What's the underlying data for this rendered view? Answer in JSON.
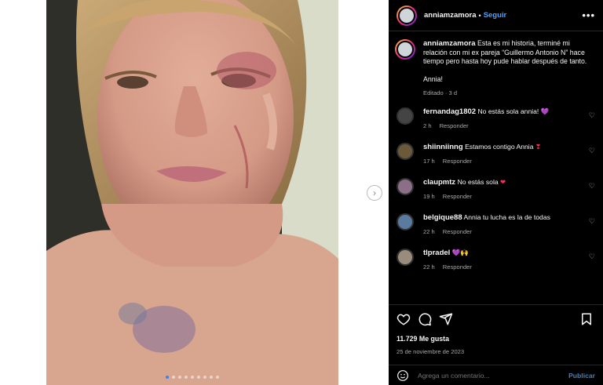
{
  "post": {
    "username": "anniamzamora",
    "follow_label": "Seguir",
    "more_label": "•••",
    "image_dots": 9,
    "active_dot": 0
  },
  "caption": {
    "username": "anniamzamora",
    "text": "Esta es mi historia, terminé mi relación con mi ex pareja “Guillermo Antonio N” hace tiempo pero hasta hoy pude hablar después de tanto.",
    "signature": "Annia!",
    "meta": "Editado · 3 d"
  },
  "comments": [
    {
      "username": "fernandag1802",
      "text": "No estás sola annia!",
      "emoji": "💜",
      "time": "2 h",
      "reply": "Responder",
      "avatar_color": "#444444"
    },
    {
      "username": "shiinniinng",
      "text": "Estamos contigo Annia",
      "emoji": "❣",
      "time": "17 h",
      "reply": "Responder",
      "avatar_color": "#6b5a3a"
    },
    {
      "username": "claupmtz",
      "text": "No estás sola",
      "emoji": "❤",
      "time": "19 h",
      "reply": "Responder",
      "avatar_color": "#8a6f86"
    },
    {
      "username": "belgique88",
      "text": "Annia tu lucha es la de todas",
      "emoji": "",
      "time": "22 h",
      "reply": "Responder",
      "avatar_color": "#5b7aa0"
    },
    {
      "username": "tlpradel",
      "text": "",
      "emoji": "💜🙌",
      "time": "22 h",
      "reply": "Responder",
      "avatar_color": "#9a8c7d"
    }
  ],
  "likes": "11.729 Me gusta",
  "date": "25 de noviembre de 2023",
  "add_comment": {
    "placeholder": "Agrega un comentario...",
    "publish_label": "Publicar"
  },
  "colors": {
    "panel_bg": "#000000",
    "follow": "#4aa3ff",
    "publish": "#4f7fb0",
    "muted": "#a8a8a8"
  },
  "icons": [
    "like-icon",
    "comment-icon",
    "share-icon",
    "save-icon",
    "emoji-icon",
    "chevron-right-icon",
    "more-icon",
    "heart-small-icon"
  ]
}
